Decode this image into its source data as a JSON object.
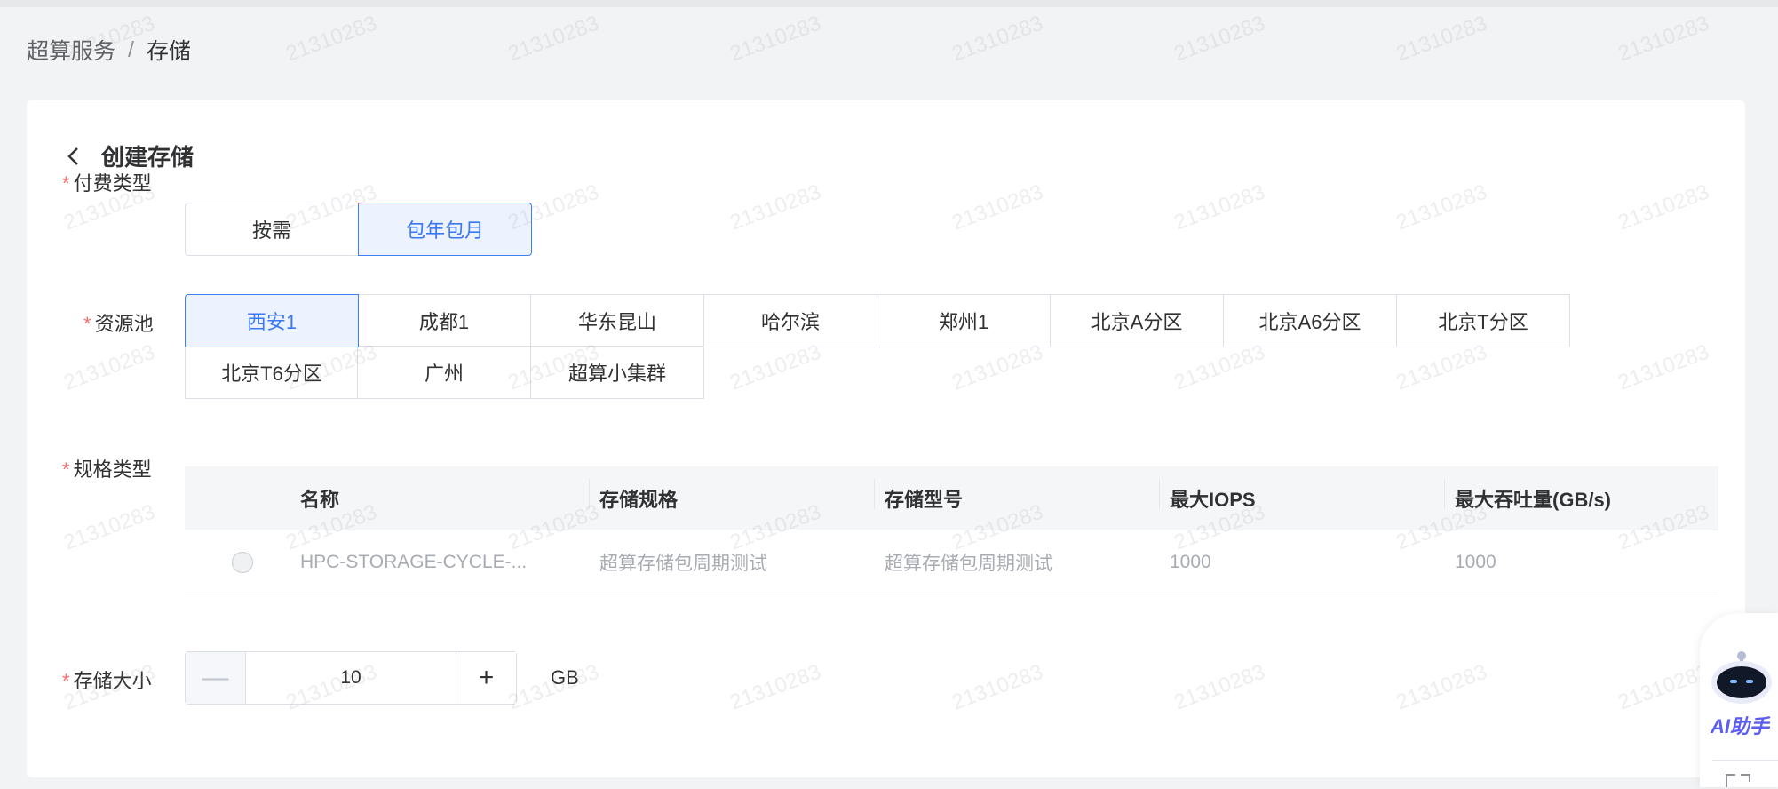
{
  "breadcrumb": {
    "parent": "超算服务",
    "separator": "/",
    "current": "存储"
  },
  "page": {
    "title": "创建存储"
  },
  "form": {
    "required_mark": "*",
    "billing": {
      "label": "付费类型",
      "options": [
        "按需",
        "包年包月"
      ],
      "selected": "包年包月"
    },
    "pool": {
      "label": "资源池",
      "options": [
        "西安1",
        "成都1",
        "华东昆山",
        "哈尔滨",
        "郑州1",
        "北京A分区",
        "北京A6分区",
        "北京T分区",
        "北京T6分区",
        "广州",
        "超算小集群"
      ],
      "selected": "西安1"
    },
    "spec": {
      "label": "规格类型",
      "columns": [
        "名称",
        "存储规格",
        "存储型号",
        "最大IOPS",
        "最大吞吐量(GB/s)"
      ],
      "rows": [
        [
          "HPC-STORAGE-CYCLE-...",
          "超算存储包周期测试",
          "超算存储包周期测试",
          "1000",
          "1000"
        ]
      ]
    },
    "size": {
      "label": "存储大小",
      "value": "10",
      "minus": "—",
      "plus": "+",
      "unit": "GB"
    }
  },
  "watermark": "21310283",
  "ai_assistant": {
    "label": "AI助手"
  },
  "colors": {
    "accent": "#3a78f2",
    "required": "#f56c6c",
    "background": "#f2f3f5"
  }
}
